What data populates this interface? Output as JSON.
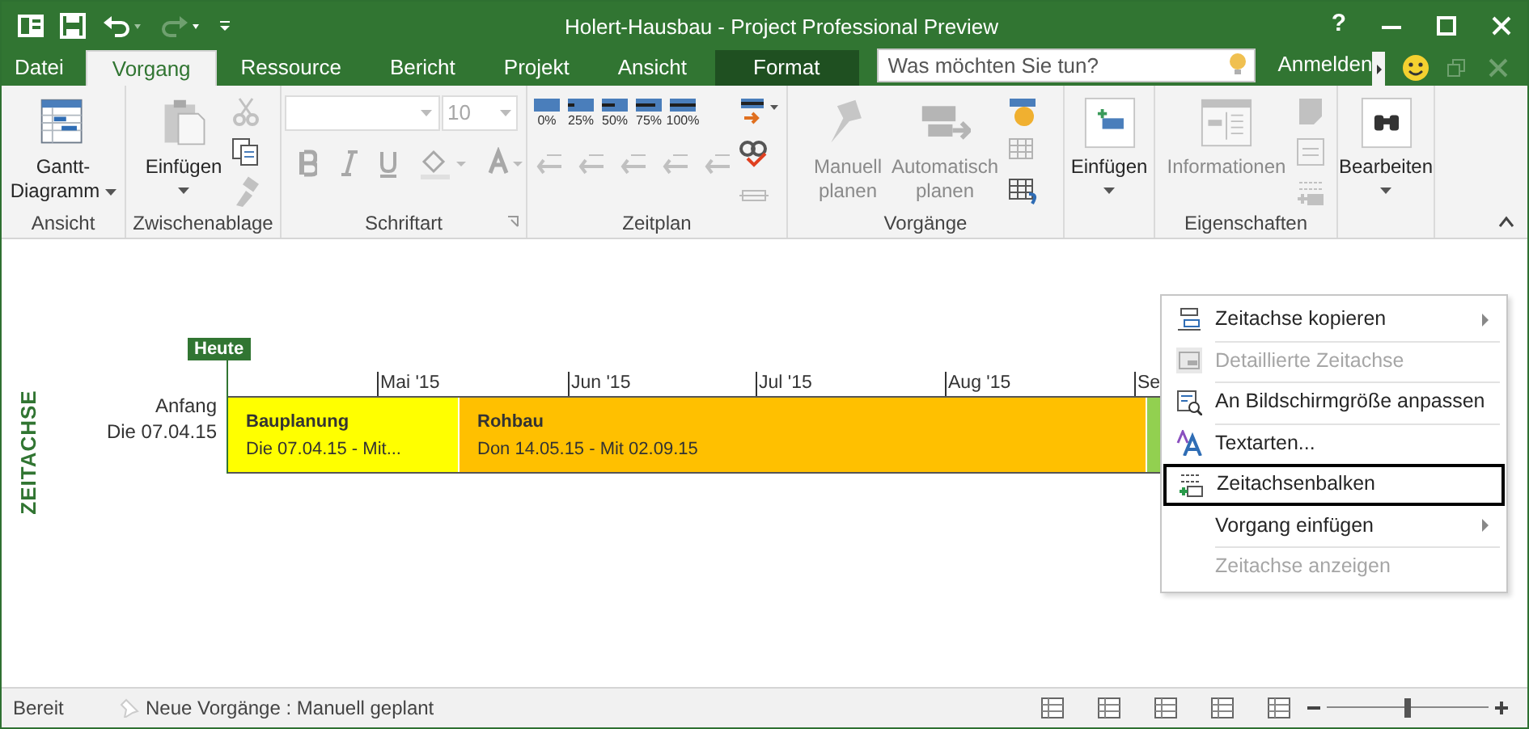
{
  "window": {
    "title": "Holert-Hausbau - Project Professional Preview",
    "help": "?"
  },
  "tabs": [
    {
      "label": "Datei",
      "selected": false,
      "kind": "file"
    },
    {
      "label": "Vorgang",
      "selected": true,
      "kind": "tab"
    },
    {
      "label": "Ressource",
      "selected": false,
      "kind": "tab"
    },
    {
      "label": "Bericht",
      "selected": false,
      "kind": "tab"
    },
    {
      "label": "Projekt",
      "selected": false,
      "kind": "tab"
    },
    {
      "label": "Ansicht",
      "selected": false,
      "kind": "tab"
    },
    {
      "label": "Format",
      "selected": false,
      "kind": "contextual"
    }
  ],
  "search": {
    "placeholder": "Was möchten Sie tun?"
  },
  "account": {
    "label": "Anmelden"
  },
  "ribbon": {
    "groups": [
      {
        "label": "Ansicht",
        "items": [
          {
            "kind": "large",
            "lines": [
              "Gantt-",
              "Diagramm"
            ],
            "dropdown": true,
            "disabled": false
          }
        ]
      },
      {
        "label": "Zwischenablage",
        "items": [
          {
            "kind": "large",
            "lines": [
              "Einfügen"
            ],
            "dropdown": true,
            "disabled": false
          },
          {
            "kind": "small",
            "disabled": true
          },
          {
            "kind": "small",
            "disabled": false
          },
          {
            "kind": "small",
            "disabled": true
          }
        ]
      },
      {
        "label": "Schriftart",
        "launcher": true,
        "items": [
          {
            "kind": "font",
            "size": "10",
            "disabled": true
          }
        ]
      },
      {
        "label": "Zeitplan",
        "items": [
          {
            "kind": "percent",
            "labels": [
              "0%",
              "25%",
              "50%",
              "75%",
              "100%"
            ]
          }
        ]
      },
      {
        "label": "Vorgänge",
        "items": [
          {
            "kind": "large",
            "lines": [
              "Manuell",
              "planen"
            ],
            "dropdown": false,
            "disabled": true
          },
          {
            "kind": "large",
            "lines": [
              "Automatisch",
              "planen"
            ],
            "dropdown": false,
            "disabled": true
          },
          {
            "kind": "small",
            "disabled": false
          },
          {
            "kind": "small",
            "disabled": true
          },
          {
            "kind": "small",
            "disabled": false
          }
        ]
      },
      {
        "items": [
          {
            "kind": "large",
            "lines": [
              "Einfügen"
            ],
            "dropdown": true,
            "disabled": false
          }
        ]
      },
      {
        "label": "Eigenschaften",
        "items": [
          {
            "kind": "large",
            "lines": [
              "Informationen"
            ],
            "dropdown": false,
            "disabled": true
          },
          {
            "kind": "small",
            "disabled": true
          },
          {
            "kind": "small",
            "disabled": true
          },
          {
            "kind": "small",
            "disabled": true
          }
        ]
      },
      {
        "items": [
          {
            "kind": "large",
            "lines": [
              "Bearbeiten"
            ],
            "dropdown": true,
            "disabled": false
          }
        ]
      }
    ]
  },
  "timeline": {
    "axis_label": "ZEITACHSE",
    "today": "Heute",
    "start": [
      "Anfang",
      "Die 07.04.15"
    ],
    "months": [
      "Mai '15",
      "Jun '15",
      "Jul '15",
      "Aug '15",
      "Se"
    ],
    "bars": [
      {
        "name": "Bauplanung",
        "dates": "Die 07.04.15 - Mit...",
        "color": "#ffff00"
      },
      {
        "name": "Rohbau",
        "dates": "Don 14.05.15 - Mit 02.09.15",
        "color": "#ffc000"
      },
      {
        "color": "#92d050"
      }
    ]
  },
  "context_menu": {
    "items": [
      {
        "label": "Zeitachse kopieren",
        "disabled": false,
        "submenu": true,
        "selected": false
      },
      {
        "label": "Detaillierte Zeitachse",
        "disabled": true,
        "submenu": false,
        "selected": false
      },
      {
        "label": "An Bildschirmgröße anpassen",
        "disabled": false,
        "submenu": false,
        "selected": false
      },
      {
        "label": "Textarten...",
        "disabled": false,
        "submenu": false,
        "selected": false
      },
      {
        "label": "Zeitachsenbalken",
        "disabled": false,
        "submenu": false,
        "selected": true
      },
      {
        "label": "Vorgang einfügen",
        "disabled": false,
        "submenu": true,
        "selected": false
      },
      {
        "label": "Zeitachse anzeigen",
        "disabled": true,
        "submenu": false,
        "selected": false
      }
    ]
  },
  "status_bar": {
    "status": "Bereit",
    "new_tasks": "Neue Vorgänge : Manuell geplant",
    "zoom": {
      "level": 0.5
    }
  }
}
